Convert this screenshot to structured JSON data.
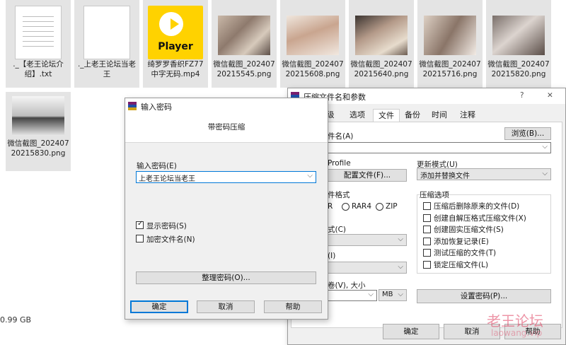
{
  "explorer": {
    "status_size": "0.99 GB",
    "files": [
      {
        "name": "._【老王论坛介绍】.txt",
        "type": "doc"
      },
      {
        "name": "._上老王论坛当老王",
        "type": "blank"
      },
      {
        "name": "绮罗罗香织FZ77中字无码.mp4",
        "type": "player",
        "icon_text": "Player"
      },
      {
        "name": "微信截图_20240720215545.png",
        "type": "photo"
      },
      {
        "name": "微信截图_20240720215608.png",
        "type": "photo"
      },
      {
        "name": "微信截图_20240720215640.png",
        "type": "photo"
      },
      {
        "name": "微信截图_20240720215716.png",
        "type": "photo"
      },
      {
        "name": "微信截图_20240720215820.png",
        "type": "photo"
      },
      {
        "name": "微信截图_20240720215830.png",
        "type": "photo"
      }
    ]
  },
  "archive_dialog": {
    "title": "压缩文件名和参数",
    "help_glyph": "?",
    "close_glyph": "✕",
    "tabs": [
      "级",
      "选项",
      "文件",
      "备份",
      "时间",
      "注释"
    ],
    "filename_label": "件名(A)",
    "browse_button": "浏览(B)...",
    "filename_value": "",
    "profile_label": "Profile",
    "profile_button": "配置文件(F)...",
    "update_mode_label": "更新模式(U)",
    "update_mode_value": "添加并替换文件",
    "format_label": "件格式",
    "format_options": [
      "R",
      "RAR4",
      "ZIP"
    ],
    "method_label": "式(C)",
    "dict_label": "(I)",
    "split_label": "卷(V), 大小",
    "split_unit": "MB",
    "options_title": "压缩选项",
    "options": [
      {
        "label": "压缩后删除原来的文件(D)",
        "checked": false
      },
      {
        "label": "创建自解压格式压缩文件(X)",
        "checked": false
      },
      {
        "label": "创建固实压缩文件(S)",
        "checked": false
      },
      {
        "label": "添加恢复记录(E)",
        "checked": false
      },
      {
        "label": "测试压缩的文件(T)",
        "checked": false
      },
      {
        "label": "锁定压缩文件(L)",
        "checked": false
      }
    ],
    "set_password_button": "设置密码(P)...",
    "ok_button": "确定",
    "cancel_button": "取消",
    "help_button": "帮助"
  },
  "password_dialog": {
    "title": "输入密码",
    "subtitle": "带密码压缩",
    "password_label": "输入密码(E)",
    "password_value": "上老王论坛当老王",
    "show_password_label": "显示密码(S)",
    "show_password_checked": true,
    "encrypt_names_label": "加密文件名(N)",
    "encrypt_names_checked": false,
    "organize_button": "整理密码(O)...",
    "ok_button": "确定",
    "cancel_button": "取消",
    "help_button": "帮助"
  },
  "watermark": {
    "line1": "老王论坛",
    "line2": "laowang.vip",
    "color": "#e04060"
  }
}
